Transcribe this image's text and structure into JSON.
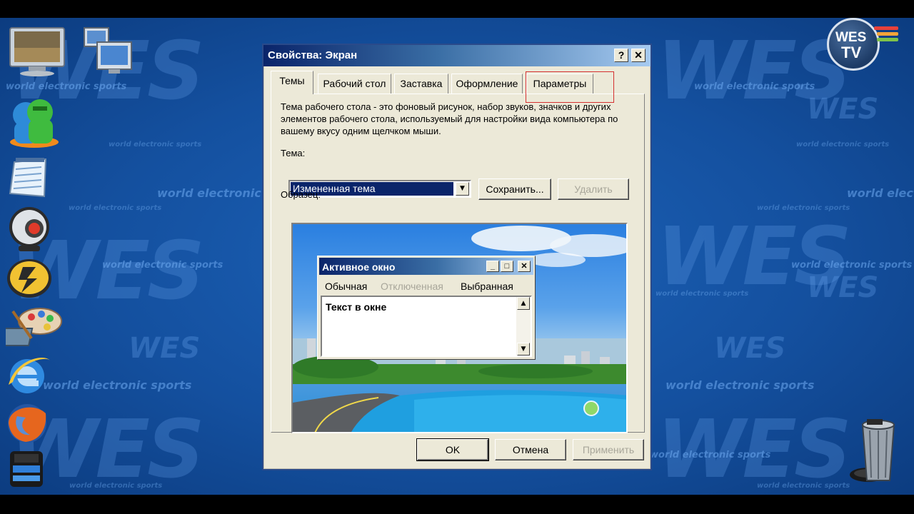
{
  "wallpaper": {
    "big_word": "WES",
    "mid_word": "WES",
    "tagline": "world electronic sports"
  },
  "logo": {
    "line1": "WES",
    "line2": "TV",
    "stripe_colors": [
      "#e8413a",
      "#f2a43a",
      "#7fc24a",
      "#3aa0e8"
    ]
  },
  "desktop_icons": [
    {
      "name": "my-computer-icon"
    },
    {
      "name": "network-icon"
    },
    {
      "name": "msn-messenger-icon"
    },
    {
      "name": "notepad-icon"
    },
    {
      "name": "webcam-icon"
    },
    {
      "name": "winamp-icon"
    },
    {
      "name": "paint-icon"
    },
    {
      "name": "internet-explorer-icon"
    },
    {
      "name": "firefox-icon"
    },
    {
      "name": "device-icon"
    }
  ],
  "dialog": {
    "title": "Свойства: Экран",
    "help_label": "?",
    "close_label": "✕",
    "tabs": [
      {
        "label": "Темы"
      },
      {
        "label": "Рабочий стол"
      },
      {
        "label": "Заставка"
      },
      {
        "label": "Оформление"
      },
      {
        "label": "Параметры"
      }
    ],
    "description": "Тема рабочего стола - это фоновый рисунок, набор звуков, значков и других элементов рабочего стола, используемый для настройки вида компьютера по вашему вкусу одним щелчком мыши.",
    "theme_label": "Тема:",
    "theme_value": "Измененная тема",
    "save_button": "Сохранить...",
    "delete_button": "Удалить",
    "sample_label": "Образец:",
    "preview": {
      "window_title": "Активное окно",
      "menu_normal": "Обычная",
      "menu_disabled": "Отключенная",
      "menu_selected": "Выбранная",
      "window_text": "Текст в окне"
    },
    "ok_button": "OK",
    "cancel_button": "Отмена",
    "apply_button": "Применить"
  }
}
